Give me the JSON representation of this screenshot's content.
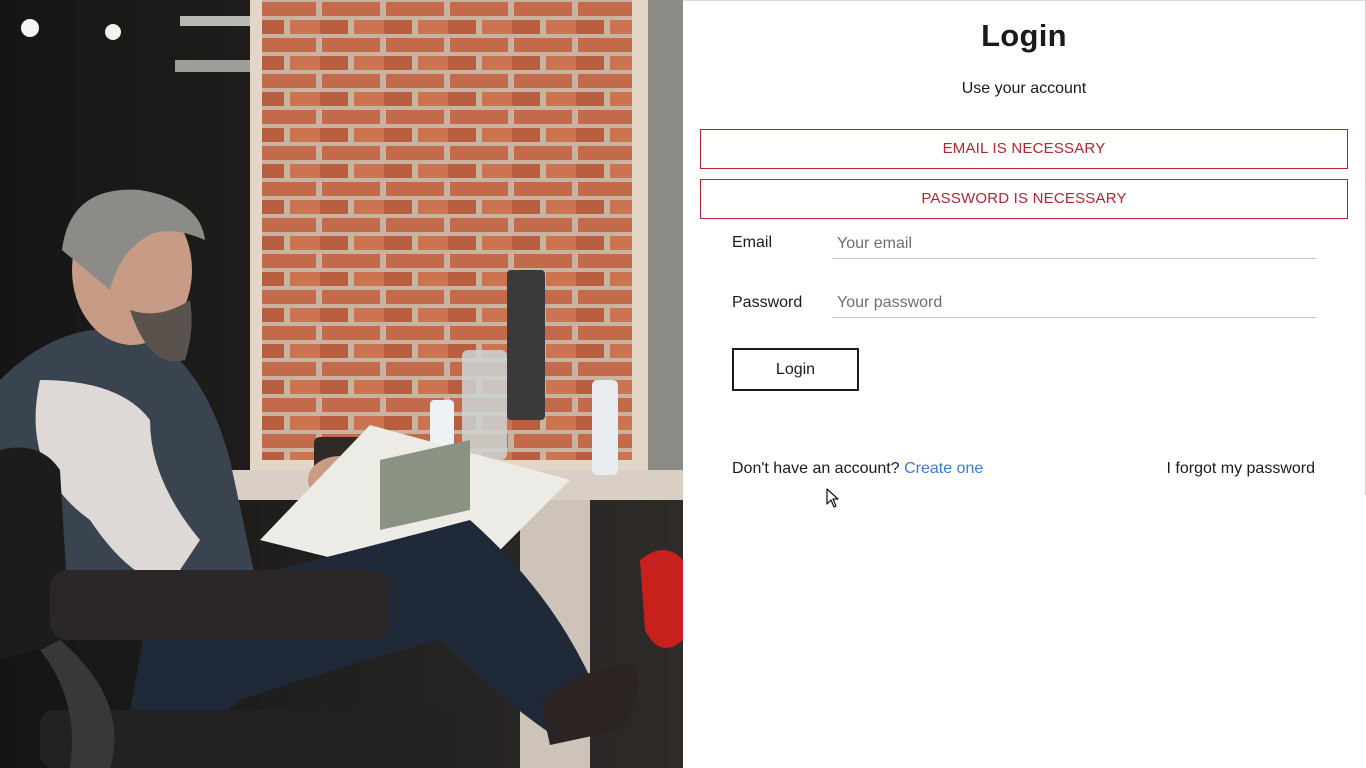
{
  "header": {
    "title": "Login",
    "subtitle": "Use your account"
  },
  "alerts": [
    {
      "text": "EMAIL IS NECESSARY",
      "color": "#b3262e"
    },
    {
      "text": "PASSWORD IS NECESSARY",
      "color": "#b3262e"
    }
  ],
  "form": {
    "email": {
      "label": "Email",
      "placeholder": "Your email",
      "value": ""
    },
    "password": {
      "label": "Password",
      "placeholder": "Your password",
      "value": ""
    },
    "submit_label": "Login"
  },
  "footer": {
    "signup_prompt": "Don't have an account?",
    "signup_link": "Create one",
    "forgot_link": "I forgot my password"
  },
  "colors": {
    "link": "#3b7ed1",
    "error": "#b3262e",
    "text": "#1a1a1a"
  },
  "icons": {
    "pointer": "mouse-pointer-icon"
  }
}
